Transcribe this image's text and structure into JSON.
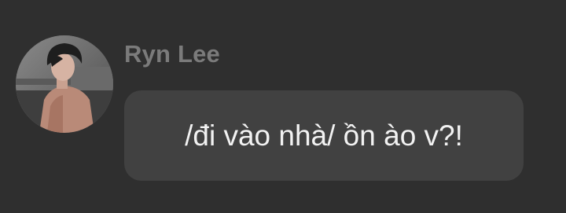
{
  "message": {
    "sender_name": "Ryn Lee",
    "text": "/đi vào nhà/ ồn ào v?!",
    "avatar_icon": "user-avatar-photo"
  },
  "colors": {
    "background": "#2f2f2f",
    "bubble": "#414141",
    "username": "#7b7b7b",
    "text": "#f2f2f2"
  }
}
